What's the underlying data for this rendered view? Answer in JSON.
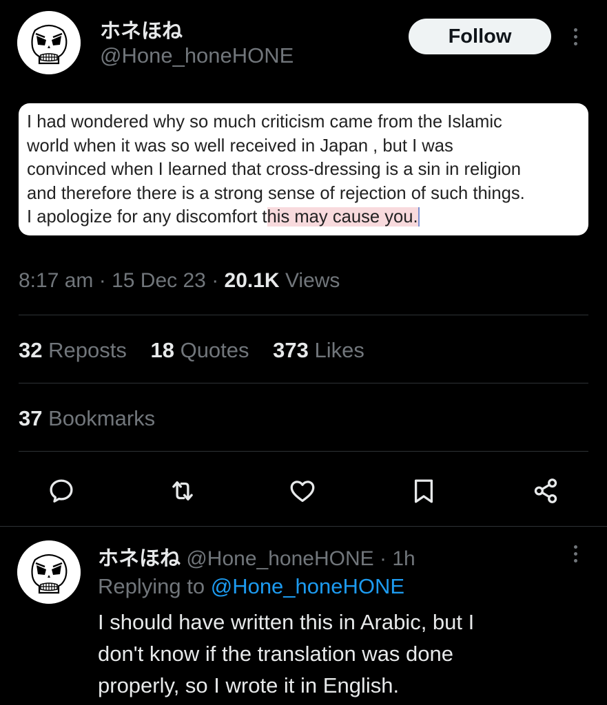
{
  "tweet": {
    "display_name": "ホネほね",
    "handle": "@Hone_honeHONE",
    "follow_label": "Follow",
    "image_text": {
      "line1": "I had wondered why so much criticism came from the Islamic",
      "line2": "world when it was so well received in Japan , but I was",
      "line3": "convinced when I learned that cross-dressing is a sin in religion",
      "line4": "and therefore there is a strong sense of rejection of such things.",
      "line5_plain": "I apologize for any discomfort t",
      "line5_highlight": "his may cause you."
    },
    "time": "8:17 am",
    "sep": "·",
    "date": "15 Dec 23",
    "views_count": "20.1K",
    "views_label": "Views",
    "reposts_count": "32",
    "reposts_label": "Reposts",
    "quotes_count": "18",
    "quotes_label": "Quotes",
    "likes_count": "373",
    "likes_label": "Likes",
    "bookmarks_count": "37",
    "bookmarks_label": "Bookmarks",
    "actions": [
      "reply-icon",
      "repost-icon",
      "like-icon",
      "bookmark-icon",
      "share-icon"
    ]
  },
  "reply": {
    "display_name": "ホネほね",
    "handle": "@Hone_honeHONE",
    "sep": "·",
    "time": "1h",
    "replying_to_label": "Replying to",
    "replying_to_handle": "@Hone_honeHONE",
    "body_line1": "I should have written this in Arabic, but I",
    "body_line2": "don't know if the translation was done",
    "body_line3": "properly, so I wrote it in English."
  },
  "colors": {
    "background": "#000000",
    "text_primary": "#e7e9ea",
    "text_secondary": "#71767b",
    "accent_link": "#1d9bf0",
    "follow_bg": "#eff3f4",
    "divider": "#2f3336",
    "highlight": "#f8dadd"
  }
}
